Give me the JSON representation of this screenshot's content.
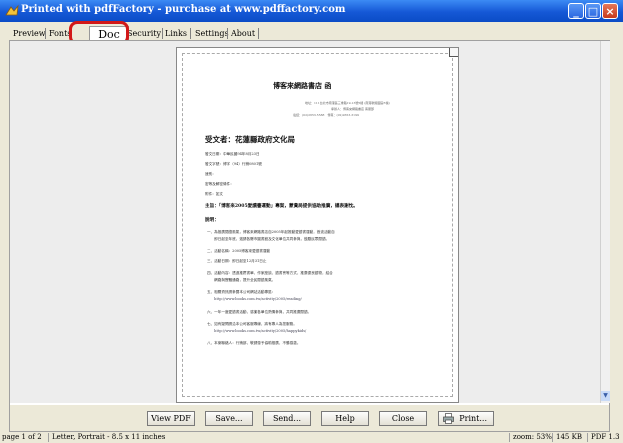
{
  "window": {
    "title": "Printed with pdfFactory - purchase at www.pdffactory.com",
    "buttons": [
      "_",
      "□",
      "×"
    ]
  },
  "tabs": [
    {
      "label": "Preview"
    },
    {
      "label": "Fonts"
    },
    {
      "label": "Doc Info"
    },
    {
      "label": "Security"
    },
    {
      "label": "Links"
    },
    {
      "label": "Settings"
    },
    {
      "label": "About"
    }
  ],
  "document": {
    "letterhead": "博客來網路書店  函",
    "address_lines": [
      "地址：111台北市南港區三重路19-13號5樓 (南港軟體園區E棟)",
      "承辦人：博客來網路書店 客服部",
      "電話：(02)2653-5588　傳真：(02)2653-3199"
    ],
    "recipient": "受文者：花蓮縣政府文化局",
    "meta_lines": [
      "發文日期：中華民國94年8月23日",
      "發文字號：博字（94）行銷0801號",
      "速別：",
      "密等及解密條件：",
      "附件：如文"
    ],
    "subject": "主旨：「博客來2005愛讀書運動」專案，蒙貴局提供協助推廣，謹表謝忱。",
    "explain_label": "說明：",
    "body_lines": [
      "一、為推廣閱讀風氣，博客來網路書店自2005年起推動愛讀書運動，首波活動自",
      "　　即日起至年底，邀請各縣市圖書館及文化單位共同參與，鼓勵民眾閱讀。",
      "二、活動名稱：2005博客來愛讀書運動",
      "三、活動日期：即日起至12月31日止",
      "四、活動內容：透過推薦書單、作家座談、讀書會等方式，推廣優良讀物，結合",
      "　　網路與實體通路，提升全民閱讀風氣。",
      "五、相關資訊請參閱本公司網站活動專區：",
      "　　http://www.books.com.tw/activity/2005/reading/",
      "六、一年一度愛讀書活動，感謝各單位熱情參與，共同推廣閱讀。",
      "七、如有疑問請洽本公司客服專線，將有專人為您服務。",
      "　　http://www.books.com.tw/activity/2005/happykids/",
      "八、本案聯絡人：行銷部，敬請惠予協助推廣，不勝感激。"
    ]
  },
  "toolbar": {
    "buttons": [
      "View PDF",
      "Save...",
      "Send...",
      "Help",
      "Close",
      "Print..."
    ]
  },
  "statusbar": {
    "page_info": "page 1 of 2",
    "paper": "Letter, Portrait - 8.5 x 11 inches",
    "zoom": "zoom: 53%",
    "size": "145 KB",
    "version": "PDF 1.3"
  },
  "colors": {
    "title_bar": "#1558d6",
    "highlight_ring": "#d21818",
    "panel_bg": "#ededed"
  }
}
